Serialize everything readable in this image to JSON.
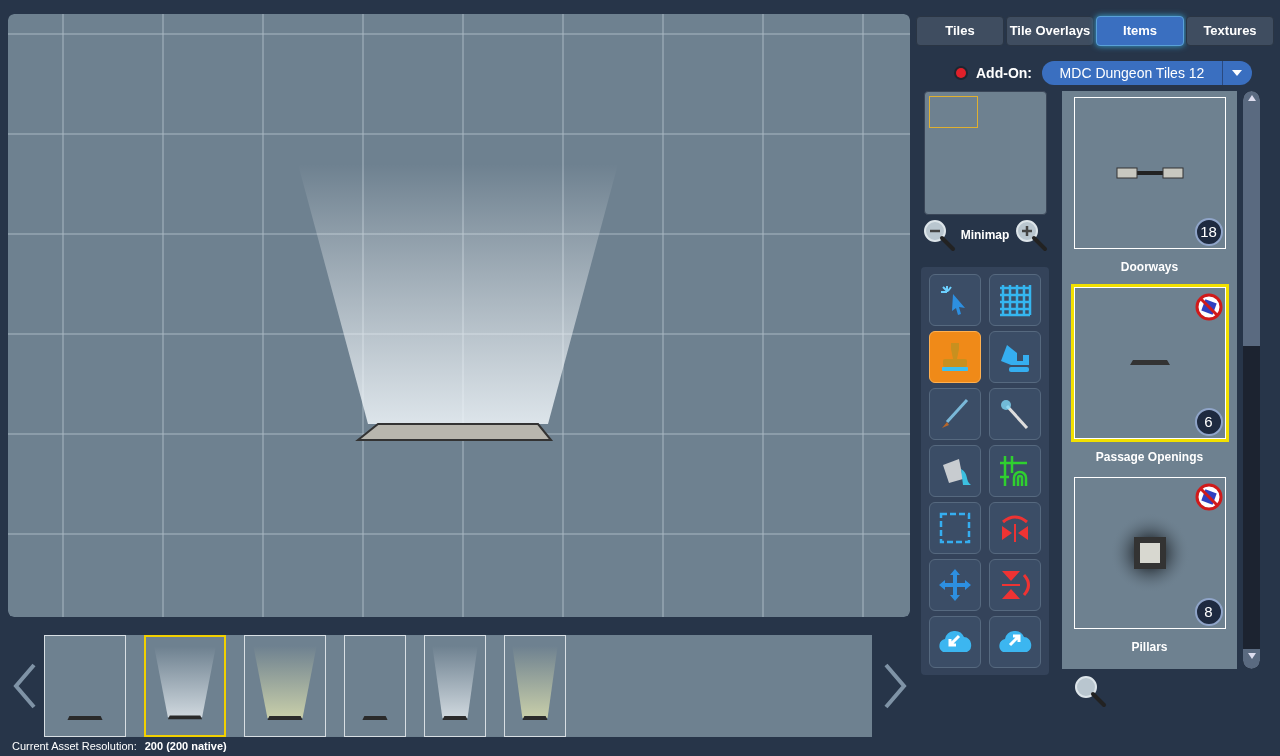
{
  "tabs": [
    {
      "label": "Tiles",
      "selected": false
    },
    {
      "label": "Tile Overlays",
      "selected": false
    },
    {
      "label": "Items",
      "selected": true
    },
    {
      "label": "Textures",
      "selected": false
    }
  ],
  "addon": {
    "label": "Add-On:",
    "value": "MDC Dungeon Tiles 12",
    "active": true
  },
  "minimap": {
    "label": "Minimap"
  },
  "tools": [
    {
      "kind": "select",
      "selected": false
    },
    {
      "kind": "grid",
      "selected": false
    },
    {
      "kind": "stamp",
      "selected": true
    },
    {
      "kind": "excavator",
      "selected": false
    },
    {
      "kind": "brush",
      "selected": false
    },
    {
      "kind": "wand",
      "selected": false
    },
    {
      "kind": "bucket",
      "selected": false
    },
    {
      "kind": "snap",
      "selected": false
    },
    {
      "kind": "marquee",
      "selected": false
    },
    {
      "kind": "mirror",
      "selected": false
    },
    {
      "kind": "move",
      "selected": false
    },
    {
      "kind": "flip",
      "selected": false
    },
    {
      "kind": "import",
      "selected": false
    },
    {
      "kind": "export",
      "selected": false
    }
  ],
  "items": [
    {
      "label": "Doorways",
      "count": "18",
      "selected": false,
      "no_random": false,
      "kind": "doorway"
    },
    {
      "label": "Passage Openings",
      "count": "6",
      "selected": true,
      "no_random": true,
      "kind": "opening"
    },
    {
      "label": "Pillars",
      "count": "8",
      "selected": false,
      "no_random": true,
      "kind": "pillar"
    }
  ],
  "variants": [
    {
      "wide": true,
      "kind": "unlit",
      "selected": false
    },
    {
      "wide": true,
      "kind": "white",
      "selected": true
    },
    {
      "wide": true,
      "kind": "yellow",
      "selected": false
    },
    {
      "wide": false,
      "kind": "unlit",
      "selected": false
    },
    {
      "wide": false,
      "kind": "white",
      "selected": false
    },
    {
      "wide": false,
      "kind": "yellow",
      "selected": false
    }
  ],
  "status": {
    "label": "Current Asset Resolution:",
    "value": "200 (200 native)"
  }
}
